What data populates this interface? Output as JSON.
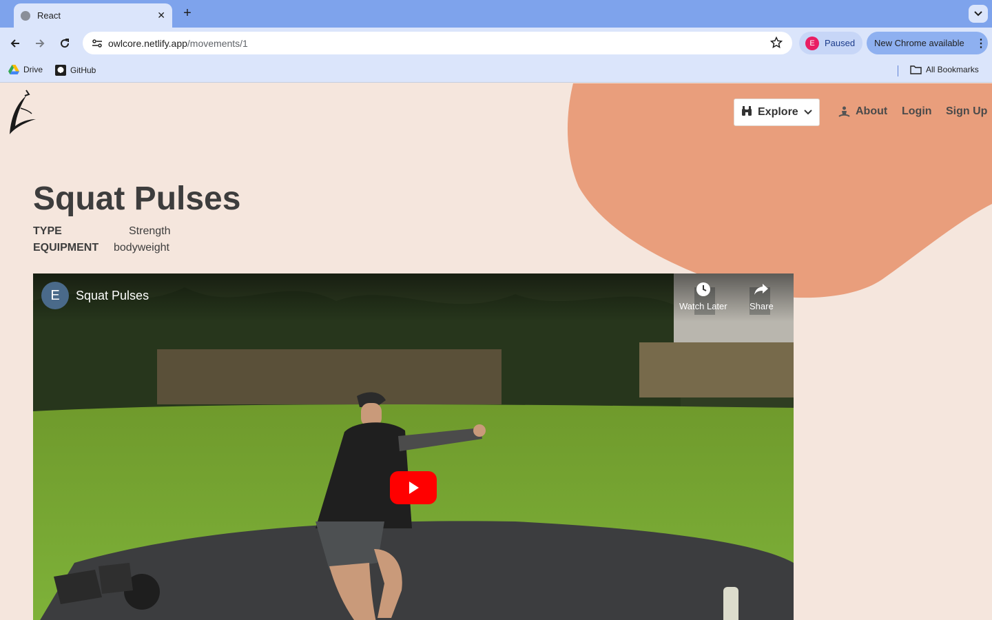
{
  "browser": {
    "tab_title": "React",
    "url_host": "owlcore.netlify.app",
    "url_path": "/movements/1",
    "profile_initial": "E",
    "profile_status": "Paused",
    "update_label": "New Chrome available",
    "bookmarks": [
      {
        "label": "Drive",
        "icon": "drive-icon"
      },
      {
        "label": "GitHub",
        "icon": "github-icon"
      }
    ],
    "all_bookmarks": "All Bookmarks"
  },
  "nav": {
    "explore": "Explore",
    "about": "About",
    "login": "Login",
    "signup": "Sign Up"
  },
  "movement": {
    "title": "Squat Pulses",
    "type_label": "TYPE",
    "type_value": "Strength",
    "equipment_label": "EQUIPMENT",
    "equipment_value": "bodyweight"
  },
  "video": {
    "channel_initial": "E",
    "title": "Squat Pulses",
    "watch_later": "Watch Later",
    "share": "Share"
  },
  "colors": {
    "page_bg": "#f5e6dd",
    "blob": "#e99e7c",
    "play": "#ff0000"
  }
}
